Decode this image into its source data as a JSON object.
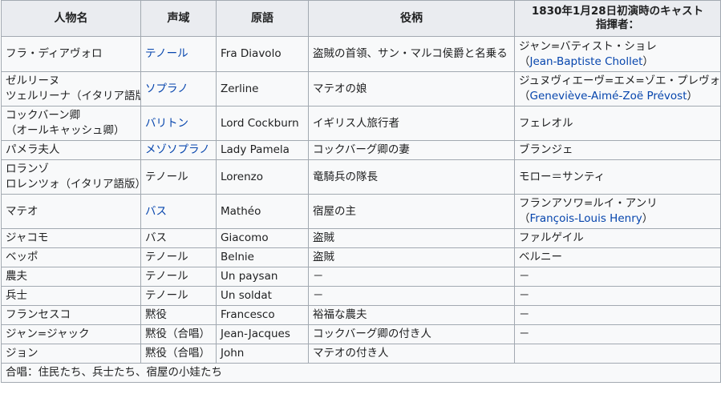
{
  "headers": {
    "role": "人物名",
    "voice": "声域",
    "original": "原語",
    "part": "役柄",
    "cast_line1": "1830年1月28日初演時のキャスト",
    "cast_line2": "指揮者："
  },
  "rows": [
    {
      "role_lines": [
        "フラ・ディアヴォロ"
      ],
      "voice": "テノール",
      "voice_link": true,
      "original": "Fra Diavolo",
      "part": "盗賊の首領、サン・マルコ侯爵と名乗る",
      "cast_line1": "ジャン=バティスト・ショレ",
      "cast_open": "（",
      "cast_link": "Jean-Baptiste Chollet",
      "cast_close": "）"
    },
    {
      "role_lines": [
        "ゼルリーヌ",
        "ツェルリーナ（イタリア語版）"
      ],
      "voice": "ソプラノ",
      "voice_link": true,
      "original": "Zerline",
      "part": "マテオの娘",
      "cast_line1": "ジュヌヴィエーヴ=エメ=ゾエ・プレヴォスト",
      "cast_open": "（",
      "cast_link": "Geneviève-Aimé-Zoë Prévost",
      "cast_close": "）"
    },
    {
      "role_lines": [
        "コックバーン卿",
        "（オールキャッシュ卿）"
      ],
      "voice": "バリトン",
      "voice_link": true,
      "original": "Lord Cockburn",
      "part": "イギリス人旅行者",
      "cast_line1": "フェレオル"
    },
    {
      "role_lines": [
        "パメラ夫人"
      ],
      "voice": "メゾソプラノ",
      "voice_link": true,
      "original": "Lady Pamela",
      "part": "コックバーグ卿の妻",
      "cast_line1": "ブランジェ"
    },
    {
      "role_lines": [
        "ロランゾ",
        "ロレンツォ（イタリア語版）"
      ],
      "voice": "テノール",
      "voice_link": false,
      "original": "Lorenzo",
      "part": "竜騎兵の隊長",
      "cast_line1": "モロー＝サンティ"
    },
    {
      "role_lines": [
        "マテオ"
      ],
      "voice": "バス",
      "voice_link": true,
      "original": "Mathéo",
      "part": "宿屋の主",
      "cast_line1": "フランアソワ=ルイ・アンリ",
      "cast_open": "（",
      "cast_link": "François-Louis Henry",
      "cast_close": "）"
    },
    {
      "role_lines": [
        "ジャコモ"
      ],
      "voice": "バス",
      "voice_link": false,
      "original": "Giacomo",
      "part": "盗賊",
      "cast_line1": "ファルゲイル"
    },
    {
      "role_lines": [
        "ベッポ"
      ],
      "voice": "テノール",
      "voice_link": false,
      "original": "Belnie",
      "part": "盗賊",
      "cast_line1": "ベルニー"
    },
    {
      "role_lines": [
        "農夫"
      ],
      "voice": "テノール",
      "voice_link": false,
      "original": "Un paysan",
      "part": "－",
      "cast_line1": "－"
    },
    {
      "role_lines": [
        "兵士"
      ],
      "voice": "テノール",
      "voice_link": false,
      "original": "Un soldat",
      "part": "－",
      "cast_line1": "－"
    },
    {
      "role_lines": [
        "フランセスコ"
      ],
      "voice": "黙役",
      "voice_link": false,
      "original": "Francesco",
      "part": "裕福な農夫",
      "cast_line1": "－"
    },
    {
      "role_lines": [
        "ジャン=ジャック"
      ],
      "voice": "黙役（合唱）",
      "voice_link": false,
      "original": "Jean-Jacques",
      "part": "コックバーグ卿の付き人",
      "cast_line1": "－"
    },
    {
      "role_lines": [
        "ジョン"
      ],
      "voice": "黙役（合唱）",
      "voice_link": false,
      "original": "John",
      "part": "マテオの付き人",
      "cast_line1": ""
    }
  ],
  "chorus_note": "合唱：住民たち、兵士たち、宿屋の小娃たち",
  "colors": {
    "link": "#0645ad",
    "header_bg": "#eaecf0",
    "cell_bg": "#f8f9fa",
    "border": "#a2a9b1"
  }
}
